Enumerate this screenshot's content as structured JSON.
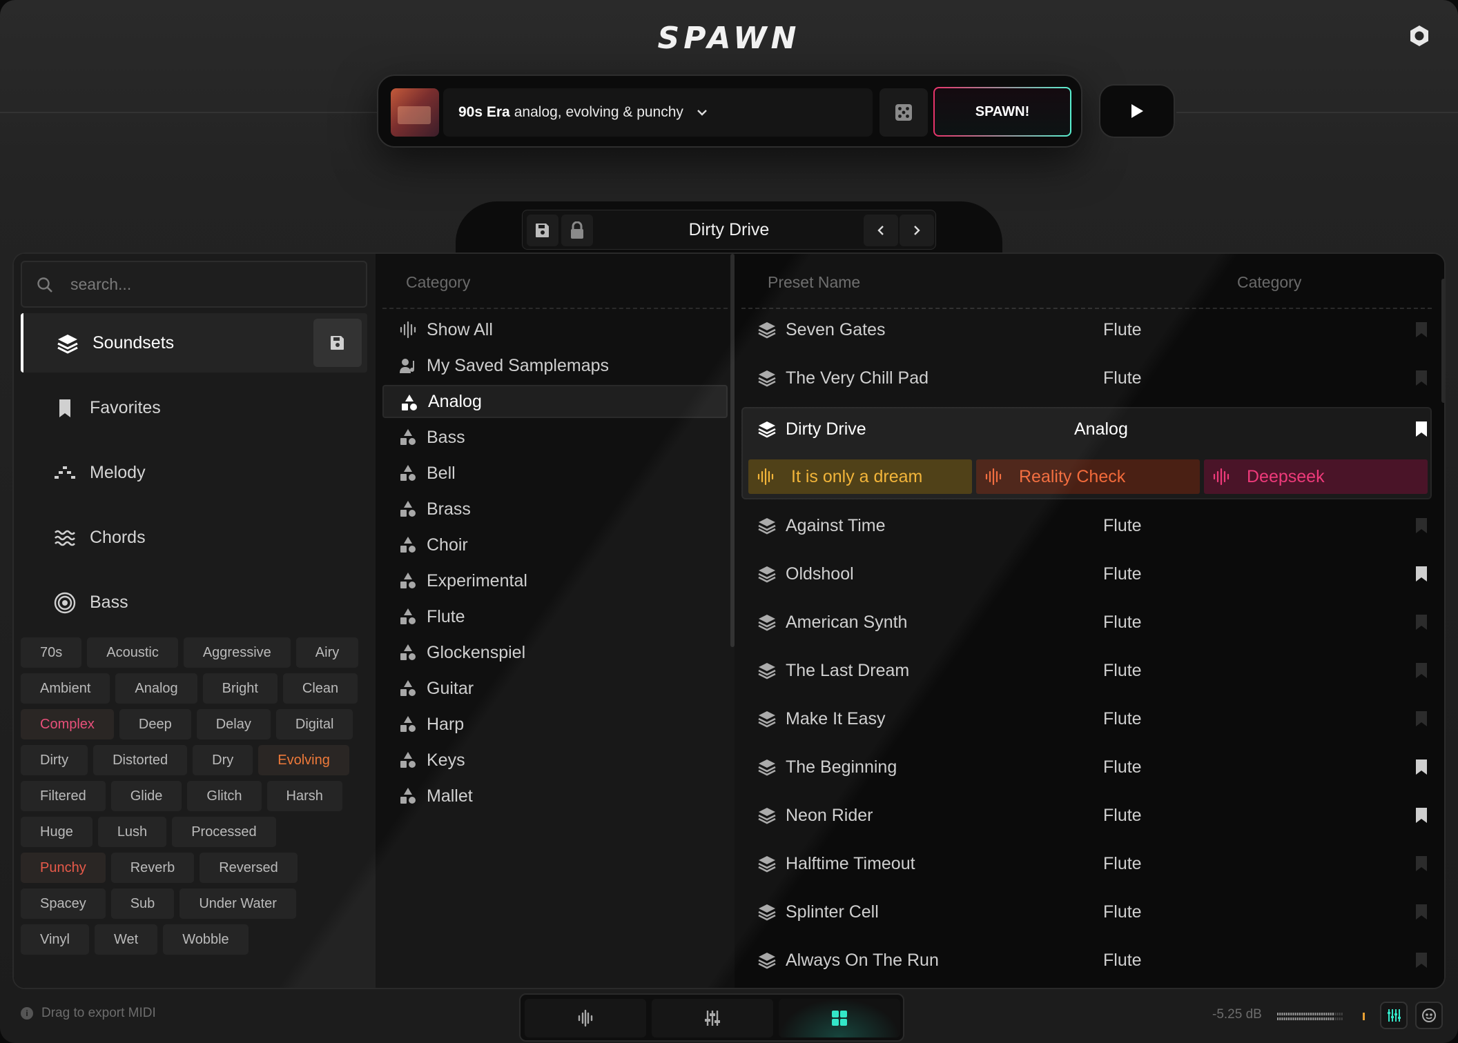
{
  "app": {
    "logo": "SPAWN"
  },
  "header": {
    "preset_bold": "90s Era",
    "preset_desc": "analog, evolving & punchy",
    "spawn_label": "SPAWN!"
  },
  "preset_nav": {
    "title": "Dirty Drive"
  },
  "search": {
    "placeholder": "search..."
  },
  "sidebar": {
    "items": [
      {
        "label": "Soundsets",
        "icon": "layers-icon",
        "active": true
      },
      {
        "label": "Favorites",
        "icon": "bookmark-icon"
      },
      {
        "label": "Melody",
        "icon": "melody-icon"
      },
      {
        "label": "Chords",
        "icon": "chords-icon"
      },
      {
        "label": "Bass",
        "icon": "bass-icon"
      }
    ]
  },
  "tags": {
    "rows": [
      [
        "70s",
        "Acoustic",
        "Aggressive",
        "Airy"
      ],
      [
        "Ambient",
        "Analog",
        "Bright",
        "Clean"
      ],
      [
        "Complex",
        "Deep",
        "Delay",
        "Digital"
      ],
      [
        "Dirty",
        "Distorted",
        "Dry",
        "Evolving"
      ],
      [
        "Filtered",
        "Glide",
        "Glitch",
        "Harsh"
      ],
      [
        "Huge",
        "Lush",
        "Processed"
      ],
      [
        "Punchy",
        "Reverb",
        "Reversed"
      ],
      [
        "Spacey",
        "Sub",
        "Under Water"
      ],
      [
        "Vinyl",
        "Wet",
        "Wobble"
      ]
    ],
    "highlighted": [
      "Complex",
      "Evolving",
      "Punchy"
    ]
  },
  "categories": {
    "header": "Category",
    "items": [
      {
        "label": "Show All",
        "icon": "waveform-icon"
      },
      {
        "label": "My Saved Samplemaps",
        "icon": "user-music-icon"
      },
      {
        "label": "Analog",
        "icon": "shapes-icon",
        "active": true
      },
      {
        "label": "Bass",
        "icon": "shapes-icon"
      },
      {
        "label": "Bell",
        "icon": "shapes-icon"
      },
      {
        "label": "Brass",
        "icon": "shapes-icon"
      },
      {
        "label": "Choir",
        "icon": "shapes-icon"
      },
      {
        "label": "Experimental",
        "icon": "shapes-icon"
      },
      {
        "label": "Flute",
        "icon": "shapes-icon"
      },
      {
        "label": "Glockenspiel",
        "icon": "shapes-icon"
      },
      {
        "label": "Guitar",
        "icon": "shapes-icon"
      },
      {
        "label": "Harp",
        "icon": "shapes-icon"
      },
      {
        "label": "Keys",
        "icon": "shapes-icon"
      },
      {
        "label": "Mallet",
        "icon": "shapes-icon"
      }
    ]
  },
  "presets": {
    "header_name": "Preset Name",
    "header_category": "Category",
    "before": [
      {
        "name": "Seven Gates",
        "category": "Flute",
        "fav": false
      },
      {
        "name": "The Very Chill Pad",
        "category": "Flute",
        "fav": false
      }
    ],
    "selected": {
      "name": "Dirty Drive",
      "category": "Analog",
      "fav": true,
      "variations": [
        {
          "label": "It is only a dream",
          "color": "#f2b233",
          "bg": "#4a3a10"
        },
        {
          "label": "Reality Check",
          "color": "#f26a3a",
          "bg": "#4a2014"
        },
        {
          "label": "Deepseek",
          "color": "#ee3a7a",
          "bg": "#4a1428"
        }
      ]
    },
    "after": [
      {
        "name": "Against Time",
        "category": "Flute",
        "fav": false
      },
      {
        "name": "Oldshool",
        "category": "Flute",
        "fav": true
      },
      {
        "name": "American Synth",
        "category": "Flute",
        "fav": false
      },
      {
        "name": "The Last Dream",
        "category": "Flute",
        "fav": false
      },
      {
        "name": "Make It Easy",
        "category": "Flute",
        "fav": false
      },
      {
        "name": "The Beginning",
        "category": "Flute",
        "fav": true
      },
      {
        "name": "Neon Rider",
        "category": "Flute",
        "fav": true
      },
      {
        "name": "Halftime Timeout",
        "category": "Flute",
        "fav": false
      },
      {
        "name": "Splinter Cell",
        "category": "Flute",
        "fav": false
      },
      {
        "name": "Always On The Run",
        "category": "Flute",
        "fav": false
      }
    ]
  },
  "footer": {
    "hint": "Drag to export MIDI",
    "level": "-5.25 dB",
    "accent": "#33e6c8"
  }
}
